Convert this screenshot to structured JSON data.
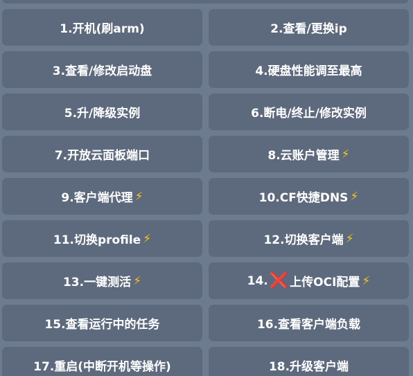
{
  "buttons": [
    {
      "label": "1.开机(刷arm)",
      "bolt": false
    },
    {
      "label": "2.查看/更换ip",
      "bolt": false
    },
    {
      "label": "3.查看/修改启动盘",
      "bolt": false
    },
    {
      "label": "4.硬盘性能调至最高",
      "bolt": false
    },
    {
      "label": "5.升/降级实例",
      "bolt": false
    },
    {
      "label": "6.断电/终止/修改实例",
      "bolt": false
    },
    {
      "label": "7.开放云面板端口",
      "bolt": false
    },
    {
      "label": "8.云账户管理",
      "bolt": true
    },
    {
      "label": "9.客户端代理",
      "bolt": true
    },
    {
      "label": "10.CF快捷DNS",
      "bolt": true
    },
    {
      "label": "11.切换profile",
      "bolt": true
    },
    {
      "label": "12.切换客户端",
      "bolt": true
    },
    {
      "label": "13.一键测活",
      "bolt": true
    },
    {
      "label_prefix": "14.",
      "label": "上传OCI配置",
      "bolt": true,
      "cross": true
    },
    {
      "label": "15.查看运行中的任务",
      "bolt": false
    },
    {
      "label": "16.查看客户端负载",
      "bolt": false
    },
    {
      "label": "17.重启(中断开机等操作)",
      "bolt": false
    },
    {
      "label": "18.升级客户端",
      "bolt": false
    }
  ],
  "icons": {
    "bolt": "⚡",
    "cross": "❌"
  },
  "colors": {
    "background": "#6d7b8e",
    "button": "#5d6a7e",
    "text": "#ffffff",
    "bolt": "#f5c518",
    "cross": "#e0251b"
  }
}
